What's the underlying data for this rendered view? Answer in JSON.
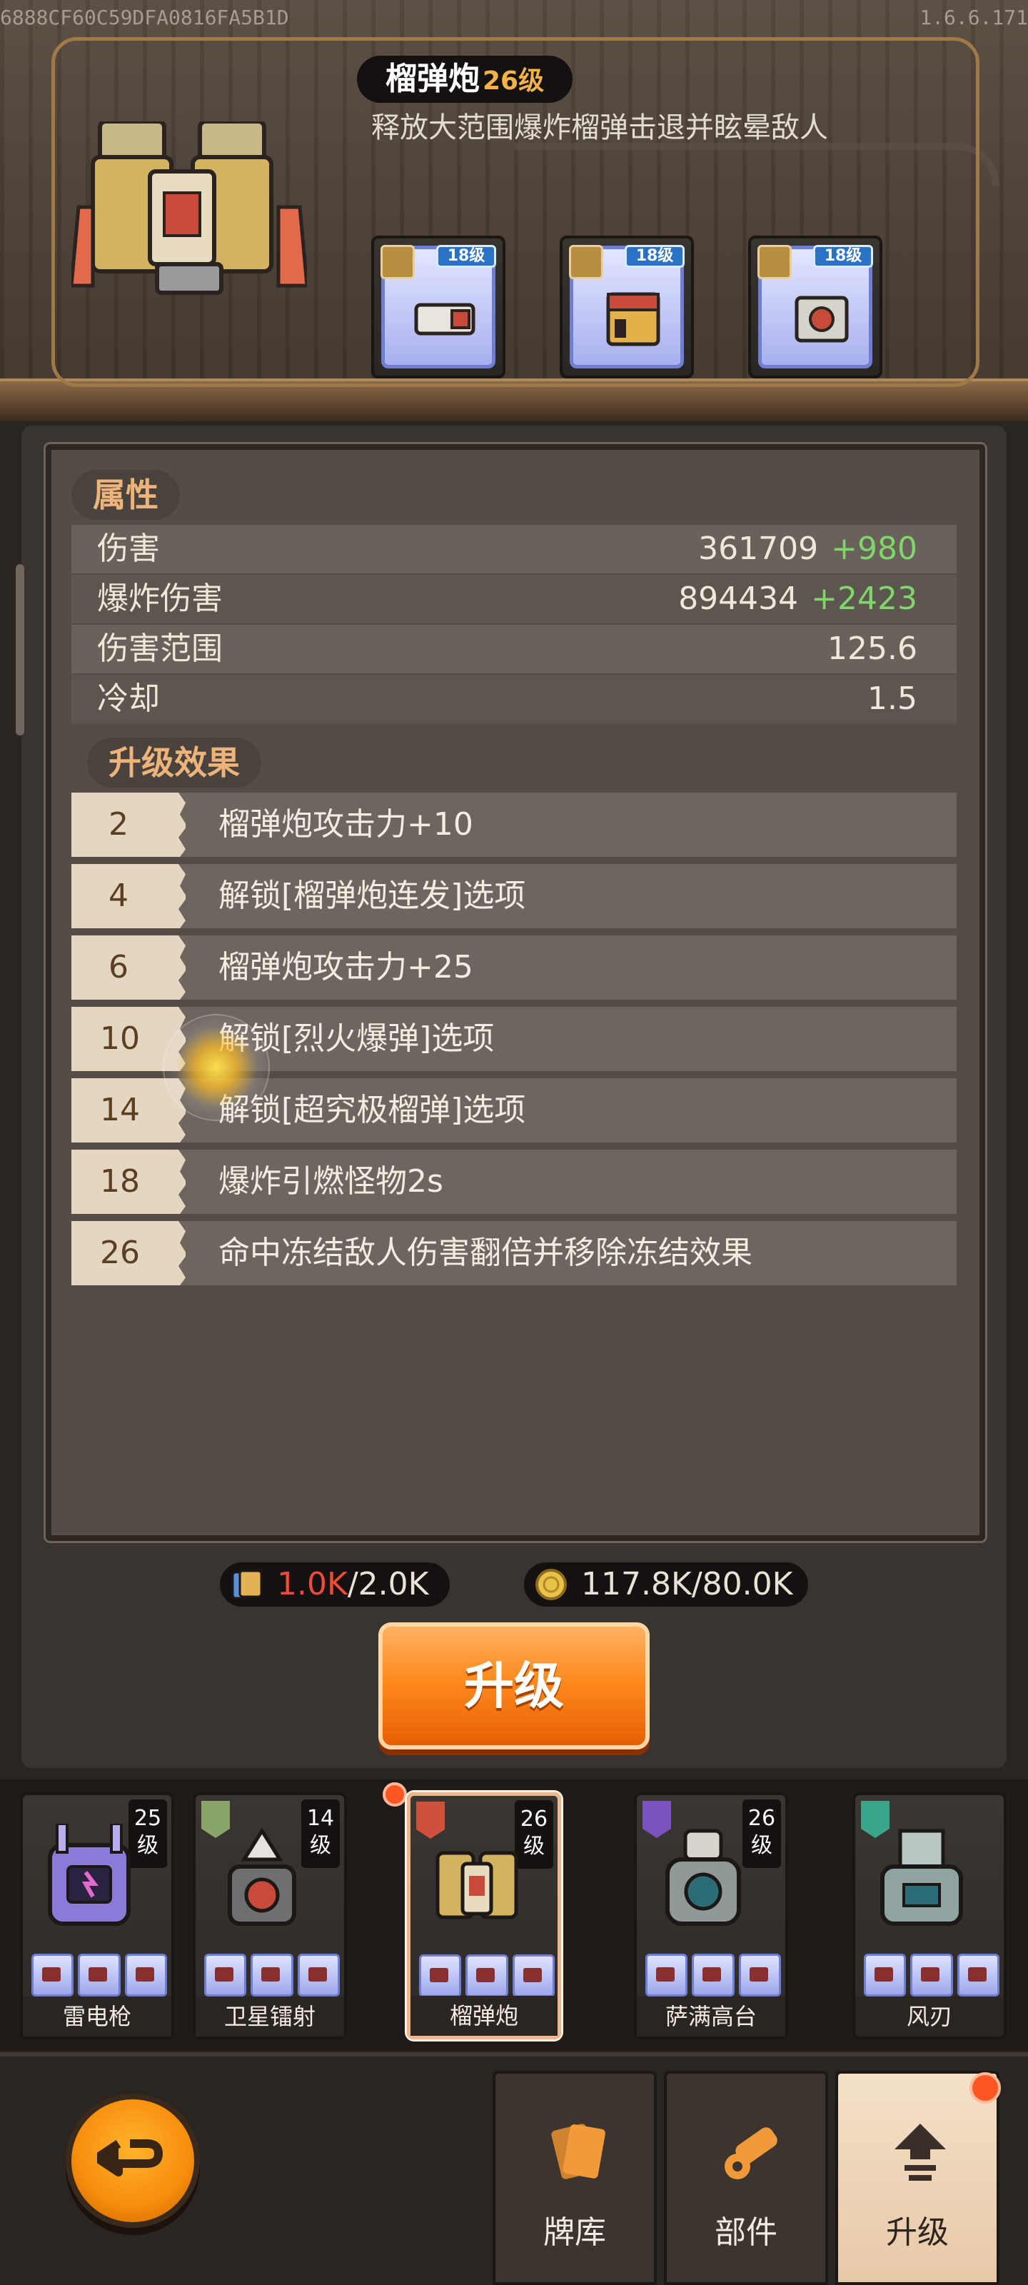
{
  "debug": {
    "build_hash": "6888CF60C59DFA0816FA5B1D",
    "version": "1.6.6.171"
  },
  "weapon": {
    "name": "榴弹炮",
    "level": "26级",
    "description": "释放大范围爆炸榴弹击退并眩晕敌人",
    "parts": [
      {
        "level": "18级",
        "icon": "barrel-part-icon"
      },
      {
        "level": "18级",
        "icon": "ammo-box-part-icon"
      },
      {
        "level": "18级",
        "icon": "core-part-icon"
      }
    ]
  },
  "attributes": {
    "title": "属性",
    "rows": [
      {
        "label": "伤害",
        "value": "361709",
        "bonus": "+980"
      },
      {
        "label": "爆炸伤害",
        "value": "894434",
        "bonus": "+2423"
      },
      {
        "label": "伤害范围",
        "value": "125.6",
        "bonus": ""
      },
      {
        "label": "冷却",
        "value": "1.5",
        "bonus": ""
      }
    ]
  },
  "upgrade_effects": {
    "title": "升级效果",
    "rows": [
      {
        "level": "2",
        "text": "榴弹炮攻击力+10"
      },
      {
        "level": "4",
        "text": "解锁[榴弹炮连发]选项"
      },
      {
        "level": "6",
        "text": "榴弹炮攻击力+25"
      },
      {
        "level": "10",
        "text": "解锁[烈火爆弹]选项"
      },
      {
        "level": "14",
        "text": "解锁[超究极榴弹]选项"
      },
      {
        "level": "18",
        "text": "爆炸引燃怪物2s"
      },
      {
        "level": "26",
        "text": "命中冻结敌人伤害翻倍并移除冻结效果"
      }
    ]
  },
  "resources": {
    "cards_current": "1.0K",
    "cards_max": "/2.0K",
    "gold": "117.8K/80.0K"
  },
  "upgrade_button": "升级",
  "weapons": [
    {
      "name": "雷电枪",
      "level_num": "25",
      "level_unit": "级",
      "tag_color": "#7a6fd0"
    },
    {
      "name": "卫星镭射",
      "level_num": "14",
      "level_unit": "级",
      "tag_color": "#8aa36a",
      "notify": true
    },
    {
      "name": "榴弹炮",
      "level_num": "26",
      "level_unit": "级",
      "tag_color": "#d0503c",
      "selected": true
    },
    {
      "name": "萨满高台",
      "level_num": "26",
      "level_unit": "级",
      "tag_color": "#7b52c0"
    },
    {
      "name": "风刃",
      "level_num": "",
      "level_unit": "",
      "tag_color": "#3aa58a"
    }
  ],
  "nav": {
    "tabs": [
      {
        "label": "牌库",
        "icon": "cards-icon"
      },
      {
        "label": "部件",
        "icon": "cannon-icon"
      },
      {
        "label": "升级",
        "icon": "upgrade-arrow-icon",
        "active": true
      }
    ]
  },
  "colors": {
    "accent": "#ff8a1e",
    "bonus_green": "#7fd66a",
    "level_orange": "#f3b24a",
    "resource_red": "#f04a3a"
  }
}
